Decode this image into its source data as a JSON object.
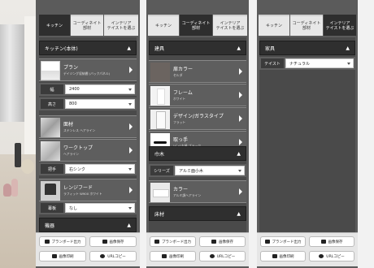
{
  "tabs": [
    "キッチン",
    "コーディネイト\n部材",
    "インテリア\nテイストを選ぶ"
  ],
  "panel1": {
    "section_title": "キッチン(本体)",
    "section2_title": "機器",
    "plan": {
      "title": "プラン",
      "sub": "デイジング収納棚 (バックパネル)"
    },
    "width": {
      "label": "幅",
      "value": "2400"
    },
    "height": {
      "label": "高さ",
      "value": "800"
    },
    "door": {
      "title": "面材",
      "sub": "ステンレス ヘアライン"
    },
    "worktop": {
      "title": "ワークトップ",
      "sub": "ヘアライン"
    },
    "handle": {
      "label": "把手",
      "value": "右シンク"
    },
    "hood": {
      "title": "レンジフード",
      "sub": "ラフィット W900 ホワイト"
    },
    "panel": {
      "label": "幕板",
      "value": "なし"
    }
  },
  "panel2": {
    "section_title": "建具",
    "wall": {
      "title": "扉カラー",
      "sub": "セルダ"
    },
    "frame": {
      "title": "フレーム",
      "sub": "ホワイト"
    },
    "glass": {
      "title": "デザイン/ガラスタイプ",
      "sub": "フラット"
    },
    "knob": {
      "title": "取っ手",
      "sub": "ﾚﾊﾞｰ1丸棒 ブラック"
    },
    "section2_title": "巾木",
    "series": {
      "label": "シリーズ",
      "value": "アルミ面小木"
    },
    "color": {
      "title": "カラー",
      "sub": "アルミ調ヘアライン"
    },
    "section3_title": "床材"
  },
  "panel3": {
    "section_title": "家具",
    "taste": {
      "label": "テイスト",
      "value": "ナチュラル"
    }
  },
  "buttons": {
    "plan_output": "プランボード出力",
    "save_image": "画像保存",
    "print_image": "画像印刷",
    "url_copy": "URLコピー"
  }
}
